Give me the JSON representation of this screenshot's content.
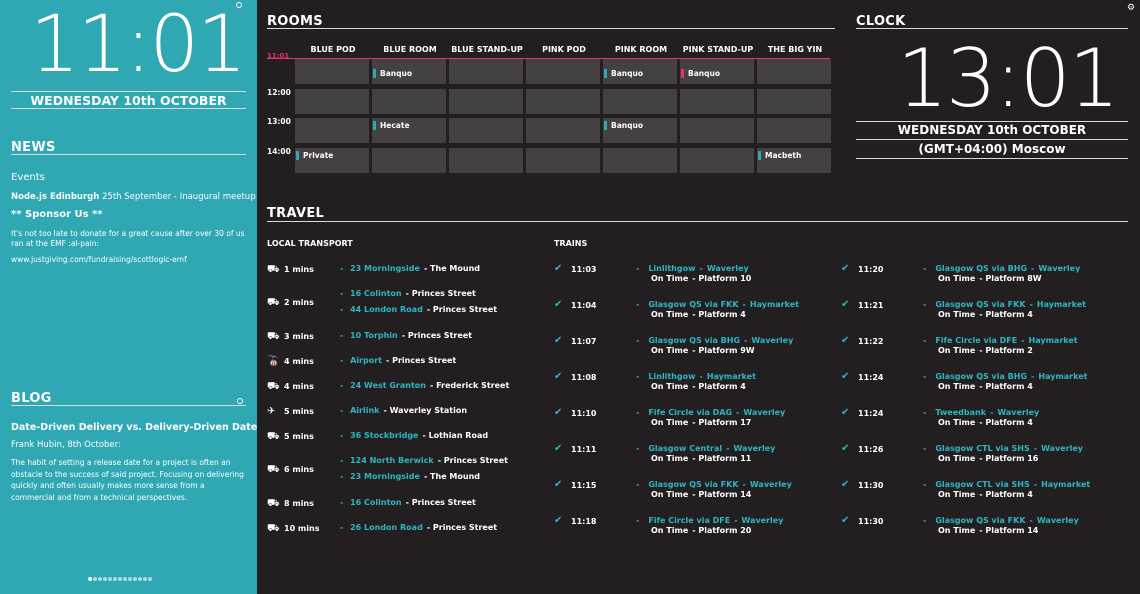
{
  "sidebar": {
    "time": "11:01",
    "date": "WEDNESDAY 10th OCTOBER",
    "news": {
      "title": "NEWS",
      "events_label": "Events",
      "event_name": "Node.js Edinburgh",
      "event_text": "25th September - Inaugural meetup",
      "sponsor_heading": "** Sponsor Us **",
      "sponsor_text": "It's not too late to donate for a great cause after over 30 of us ran at the EMF :al-pain:",
      "link": "www.justgiving.com/fundraising/scottlogic-emf"
    },
    "blog": {
      "title": "BLOG",
      "post_title": "Date-Driven Delivery vs. Delivery-Driven Dates",
      "author": "Frank Hubin, 8th October:",
      "excerpt": "The habit of setting a release date for a project is often an obstacle to the success of said project. Focusing on delivering quickly and often usually makes more sense from a commercial and from a technical perspectives."
    }
  },
  "rooms": {
    "title": "ROOMS",
    "current_time": "11:01",
    "columns": [
      "BLUE POD",
      "BLUE ROOM",
      "BLUE STAND-UP",
      "PINK POD",
      "PINK ROOM",
      "PINK STAND-UP",
      "THE BIG YIN"
    ],
    "times": [
      "12:00",
      "13:00",
      "14:00"
    ],
    "bookings": [
      {
        "col": 1,
        "row": 0,
        "label": "Banquo",
        "color": "#2fa8b4"
      },
      {
        "col": 4,
        "row": 0,
        "label": "Banquo",
        "color": "#2fa8b4"
      },
      {
        "col": 5,
        "row": 0,
        "label": "Banquo",
        "color": "#e5316f"
      },
      {
        "col": 1,
        "row": 2,
        "label": "Hecate",
        "color": "#2fa8b4"
      },
      {
        "col": 4,
        "row": 2,
        "label": "Banquo",
        "color": "#2fa8b4"
      },
      {
        "col": 0,
        "row": 3,
        "label": "Private",
        "color": "#2fa8b4"
      },
      {
        "col": 6,
        "row": 3,
        "label": "Macbeth",
        "color": "#2fa8b4"
      }
    ]
  },
  "clock": {
    "title": "CLOCK",
    "time": "13:01",
    "date": "WEDNESDAY 10th OCTOBER",
    "tz": "(GMT+04:00) Moscow"
  },
  "travel": {
    "title": "TRAVEL",
    "local_label": "LOCAL TRANSPORT",
    "trains_label": "TRAINS",
    "local": [
      {
        "icon": "bus-icon",
        "time": "1 mins",
        "routes": [
          {
            "num": "23 Morningside",
            "dest": "The Mound"
          }
        ]
      },
      {
        "icon": "bus-icon",
        "time": "2 mins",
        "routes": [
          {
            "num": "16 Colinton",
            "dest": "Princes Street"
          },
          {
            "num": "44 London Road",
            "dest": "Princes Street"
          }
        ]
      },
      {
        "icon": "bus-icon",
        "time": "3 mins",
        "routes": [
          {
            "num": "10 Torphin",
            "dest": "Princes Street"
          }
        ]
      },
      {
        "icon": "tram-icon",
        "time": "4 mins",
        "routes": [
          {
            "num": "Airport",
            "dest": "Princes Street"
          }
        ]
      },
      {
        "icon": "bus-icon",
        "time": "4 mins",
        "routes": [
          {
            "num": "24 West Granton",
            "dest": "Frederick Street"
          }
        ]
      },
      {
        "icon": "plane-icon",
        "time": "5 mins",
        "routes": [
          {
            "num": "Airlink",
            "dest": "Waverley Station"
          }
        ]
      },
      {
        "icon": "bus-icon",
        "time": "5 mins",
        "routes": [
          {
            "num": "36 Stockbridge",
            "dest": "Lothian Road"
          }
        ]
      },
      {
        "icon": "bus-icon",
        "time": "6 mins",
        "routes": [
          {
            "num": "124 North Berwick",
            "dest": "Princes Street"
          },
          {
            "num": "23 Morningside",
            "dest": "The Mound"
          }
        ]
      },
      {
        "icon": "bus-icon",
        "time": "8 mins",
        "routes": [
          {
            "num": "16 Colinton",
            "dest": "Princes Street"
          }
        ]
      },
      {
        "icon": "bus-icon",
        "time": "10 mins",
        "routes": [
          {
            "num": "26 London Road",
            "dest": "Princes Street"
          }
        ]
      }
    ],
    "trains": [
      {
        "time": "11:03",
        "from": "Linlithgow",
        "to": "Waverley",
        "status": "On Time",
        "platform": "Platform 10"
      },
      {
        "time": "11:04",
        "from": "Glasgow QS via FKK",
        "to": "Haymarket",
        "status": "On Time",
        "platform": "Platform 4"
      },
      {
        "time": "11:07",
        "from": "Glasgow QS via BHG",
        "to": "Waverley",
        "status": "On Time",
        "platform": "Platform 9W"
      },
      {
        "time": "11:08",
        "from": "Linlithgow",
        "to": "Haymarket",
        "status": "On Time",
        "platform": "Platform 4"
      },
      {
        "time": "11:10",
        "from": "Fife Circle via DAG",
        "to": "Waverley",
        "status": "On Time",
        "platform": "Platform 17"
      },
      {
        "time": "11:11",
        "from": "Glasgow Central",
        "to": "Waverley",
        "status": "On Time",
        "platform": "Platform 11"
      },
      {
        "time": "11:15",
        "from": "Glasgow QS via FKK",
        "to": "Waverley",
        "status": "On Time",
        "platform": "Platform 14"
      },
      {
        "time": "11:18",
        "from": "Fife Circle via DFE",
        "to": "Waverley",
        "status": "On Time",
        "platform": "Platform 20"
      },
      {
        "time": "11:20",
        "from": "Glasgow QS via BHG",
        "to": "Waverley",
        "status": "On Time",
        "platform": "Platform 8W"
      },
      {
        "time": "11:21",
        "from": "Glasgow QS via FKK",
        "to": "Haymarket",
        "status": "On Time",
        "platform": "Platform 4"
      },
      {
        "time": "11:22",
        "from": "Fife Circle via DFE",
        "to": "Haymarket",
        "status": "On Time",
        "platform": "Platform 2"
      },
      {
        "time": "11:24",
        "from": "Glasgow QS via BHG",
        "to": "Haymarket",
        "status": "On Time",
        "platform": "Platform 4"
      },
      {
        "time": "11:24",
        "from": "Tweedbank",
        "to": "Waverley",
        "status": "On Time",
        "platform": "Platform 4"
      },
      {
        "time": "11:26",
        "from": "Glasgow CTL via SHS",
        "to": "Waverley",
        "status": "On Time",
        "platform": "Platform 16"
      },
      {
        "time": "11:30",
        "from": "Glasgow CTL via SHS",
        "to": "Haymarket",
        "status": "On Time",
        "platform": "Platform 4"
      },
      {
        "time": "11:30",
        "from": "Glasgow QS via FKK",
        "to": "Waverley",
        "status": "On Time",
        "platform": "Platform 14"
      }
    ]
  }
}
